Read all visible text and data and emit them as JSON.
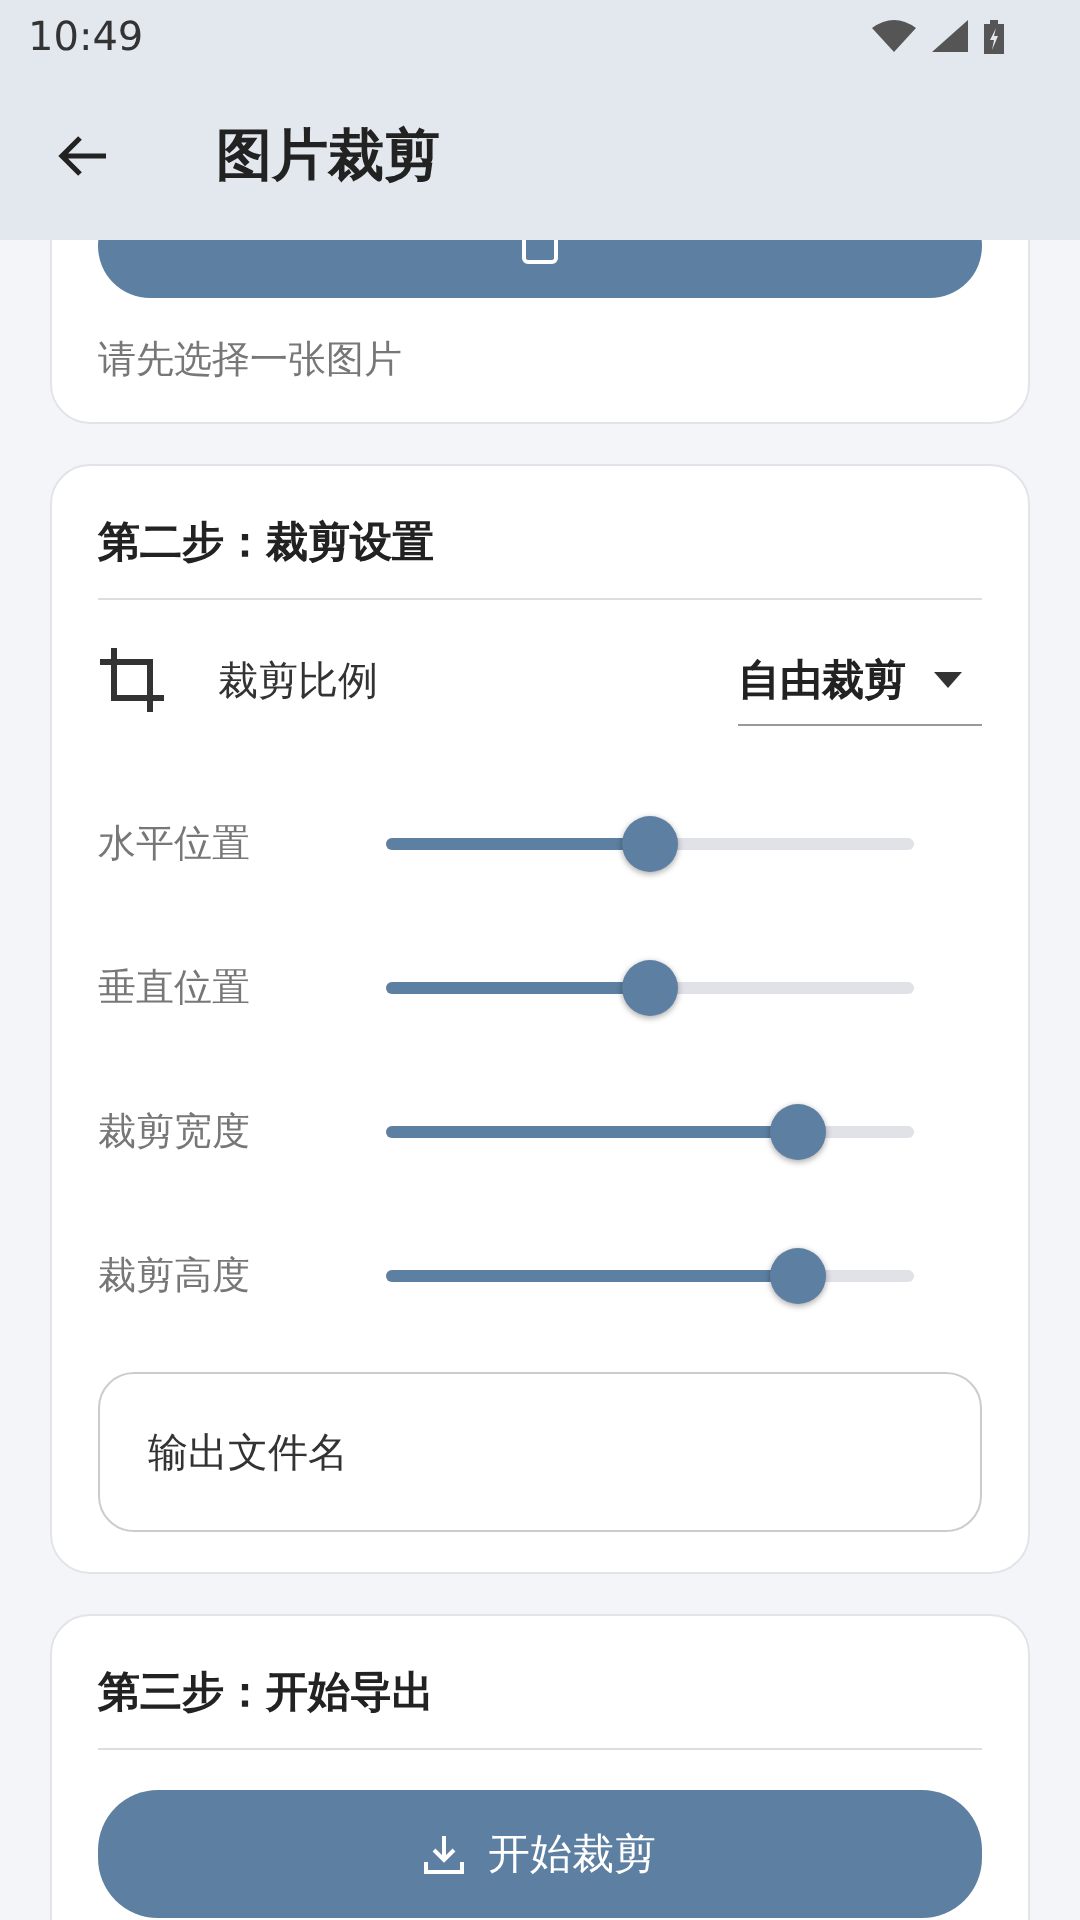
{
  "status_bar": {
    "time": "10:49"
  },
  "app_bar": {
    "title": "图片裁剪"
  },
  "step1": {
    "hint": "请先选择一张图片"
  },
  "step2": {
    "title": "第二步：裁剪设置",
    "ratio_label": "裁剪比例",
    "ratio_value": "自由裁剪",
    "sliders": [
      {
        "label": "水平位置",
        "level": 0.5
      },
      {
        "label": "垂直位置",
        "level": 0.5
      },
      {
        "label": "裁剪宽度",
        "level": 0.78
      },
      {
        "label": "裁剪高度",
        "level": 0.78
      }
    ],
    "filename": {
      "placeholder": "输出文件名"
    }
  },
  "step3": {
    "title": "第三步：开始导出",
    "button": "开始裁剪"
  }
}
